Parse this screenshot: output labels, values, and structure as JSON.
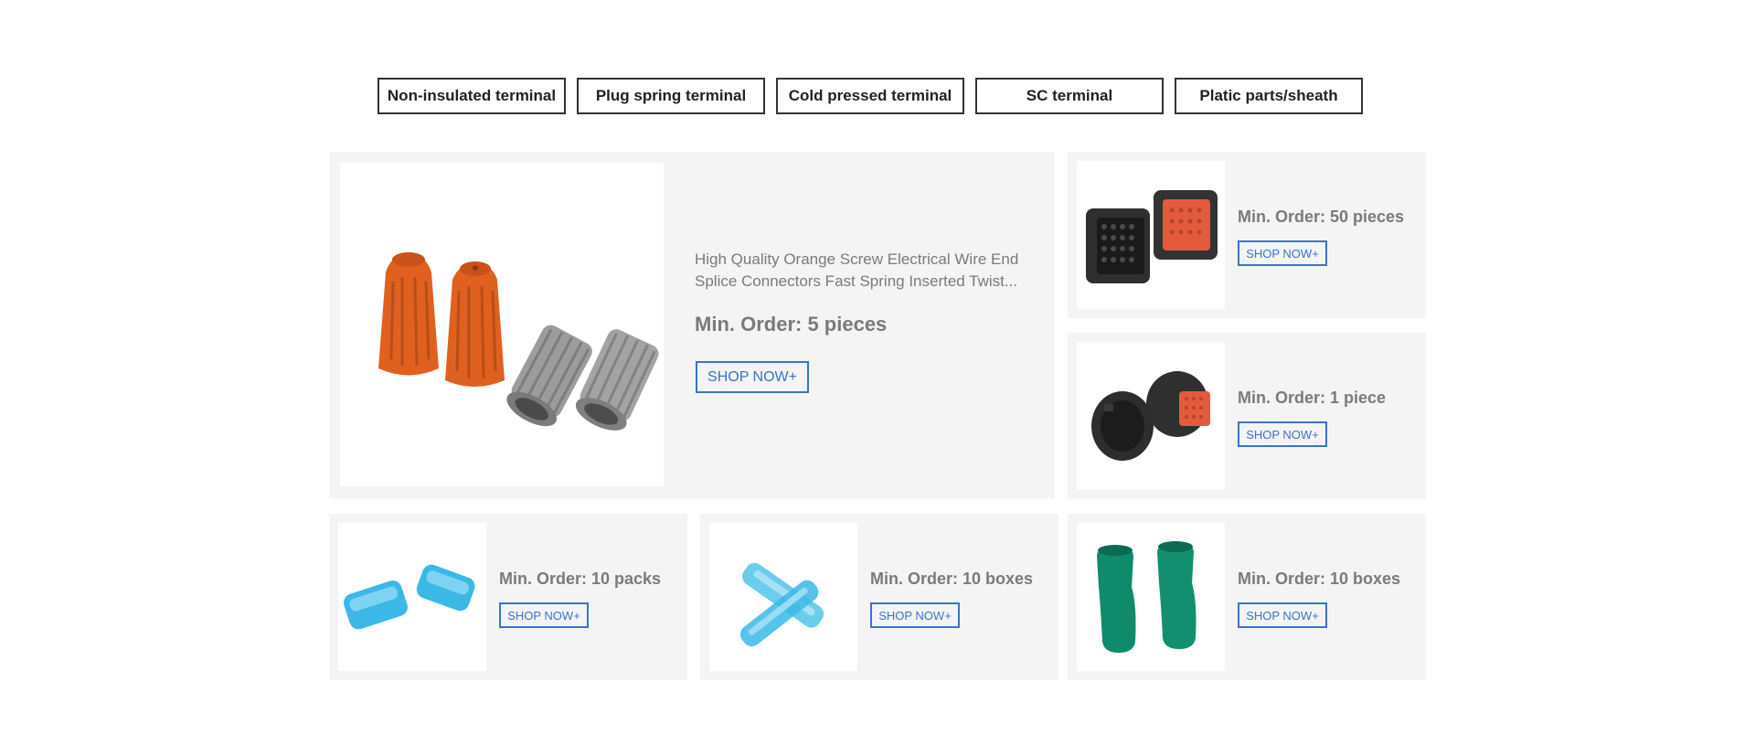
{
  "tabs": [
    {
      "label": "Non-insulated terminal"
    },
    {
      "label": "Plug spring terminal"
    },
    {
      "label": "Cold pressed terminal"
    },
    {
      "label": "SC terminal"
    },
    {
      "label": "Platic parts/sheath"
    }
  ],
  "featured": {
    "description": "High Quality Orange Screw Electrical Wire End Splice Connectors Fast Spring Inserted Twist...",
    "min_order": "Min. Order: 5 pieces",
    "shop_label": "SHOP NOW+",
    "image_icon": "orange-gray-wire-connector-image"
  },
  "products": [
    {
      "min_order": "Min. Order: 50 pieces",
      "shop_label": "SHOP NOW+",
      "image_icon": "black-red-connector-image"
    },
    {
      "min_order": "Min. Order: 1 piece",
      "shop_label": "SHOP NOW+",
      "image_icon": "round-black-connector-image"
    },
    {
      "min_order": "Min. Order: 10 packs",
      "shop_label": "SHOP NOW+",
      "image_icon": "blue-sheath-image"
    },
    {
      "min_order": "Min. Order: 10 boxes",
      "shop_label": "SHOP NOW+",
      "image_icon": "blue-terminal-sleeve-image"
    },
    {
      "min_order": "Min. Order: 10 boxes",
      "shop_label": "SHOP NOW+",
      "image_icon": "green-sheath-image"
    }
  ],
  "colors": {
    "accent": "#3a74c8",
    "panel_bg": "#f4f4f4",
    "text_gray": "#7a7a7a",
    "orange": "#e0611f",
    "gray_connector": "#9c9c9c",
    "blue_sheath": "#3bb8e6",
    "green_sheath": "#0f8a6b"
  }
}
